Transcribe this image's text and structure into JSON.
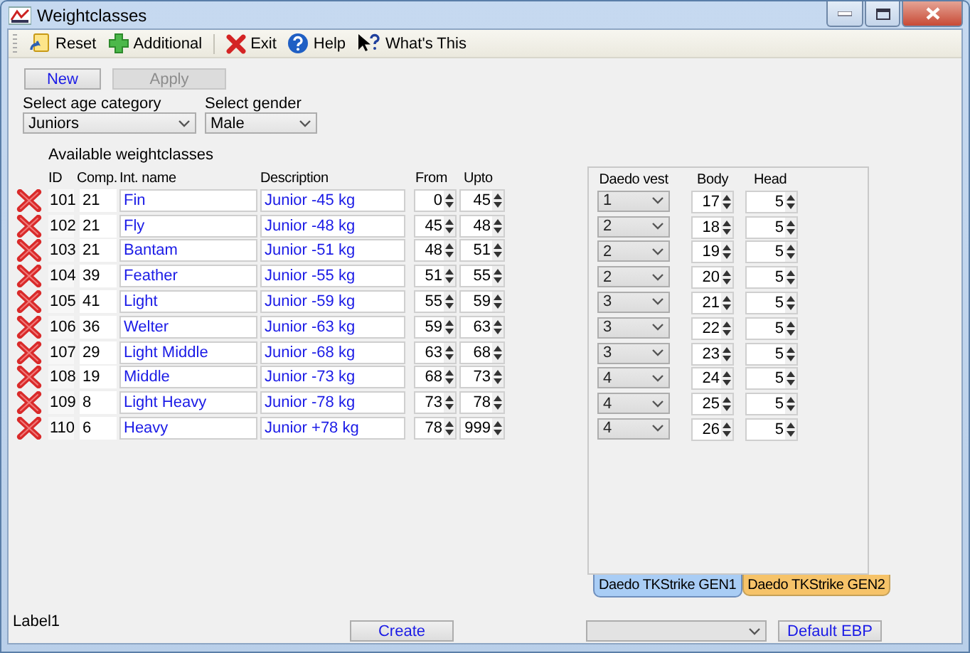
{
  "window": {
    "title": "Weightclasses"
  },
  "toolbar": [
    {
      "kind": "reset",
      "label": "Reset"
    },
    {
      "kind": "add",
      "label": "Additional"
    },
    {
      "kind": "separator"
    },
    {
      "kind": "exit",
      "label": "Exit"
    },
    {
      "kind": "help",
      "label": "Help"
    },
    {
      "kind": "whatsthis",
      "label": "What's This"
    }
  ],
  "actions": [
    {
      "label": "New",
      "disabled": false
    },
    {
      "label": "Apply",
      "disabled": true
    }
  ],
  "selects": [
    {
      "label": "Select age category",
      "value": "Juniors"
    },
    {
      "label": "Select gender",
      "value": "Male"
    }
  ],
  "section_label": "Available weightclasses",
  "columns": [
    "ID",
    "Comp.",
    "Int. name",
    "Description",
    "From",
    "Upto"
  ],
  "rows": [
    {
      "id": "101",
      "comp": "21",
      "name": "Fin",
      "description": "Junior -45 kg",
      "from": "0",
      "upto": "45"
    },
    {
      "id": "102",
      "comp": "21",
      "name": "Fly",
      "description": "Junior -48 kg",
      "from": "45",
      "upto": "48"
    },
    {
      "id": "103",
      "comp": "21",
      "name": "Bantam",
      "description": "Junior -51 kg",
      "from": "48",
      "upto": "51"
    },
    {
      "id": "104",
      "comp": "39",
      "name": "Feather",
      "description": "Junior -55 kg",
      "from": "51",
      "upto": "55"
    },
    {
      "id": "105",
      "comp": "41",
      "name": "Light",
      "description": "Junior -59 kg",
      "from": "55",
      "upto": "59"
    },
    {
      "id": "106",
      "comp": "36",
      "name": "Welter",
      "description": "Junior -63 kg",
      "from": "59",
      "upto": "63"
    },
    {
      "id": "107",
      "comp": "29",
      "name": "Light Middle",
      "description": "Junior -68 kg",
      "from": "63",
      "upto": "68"
    },
    {
      "id": "108",
      "comp": "19",
      "name": "Middle",
      "description": "Junior -73 kg",
      "from": "68",
      "upto": "73"
    },
    {
      "id": "109",
      "comp": "8",
      "name": "Light Heavy",
      "description": "Junior -78 kg",
      "from": "73",
      "upto": "78"
    },
    {
      "id": "110",
      "comp": "6",
      "name": "Heavy",
      "description": "Junior +78 kg",
      "from": "78",
      "upto": "999"
    }
  ],
  "vest_columns": [
    "Daedo vest",
    "Body",
    "Head"
  ],
  "vest_rows": [
    {
      "vest": "1",
      "body": "17",
      "head": "5"
    },
    {
      "vest": "2",
      "body": "18",
      "head": "5"
    },
    {
      "vest": "2",
      "body": "19",
      "head": "5"
    },
    {
      "vest": "2",
      "body": "20",
      "head": "5"
    },
    {
      "vest": "3",
      "body": "21",
      "head": "5"
    },
    {
      "vest": "3",
      "body": "22",
      "head": "5"
    },
    {
      "vest": "3",
      "body": "23",
      "head": "5"
    },
    {
      "vest": "4",
      "body": "24",
      "head": "5"
    },
    {
      "vest": "4",
      "body": "25",
      "head": "5"
    },
    {
      "vest": "4",
      "body": "26",
      "head": "5"
    }
  ],
  "tabs": [
    {
      "label": "Daedo TKStrike GEN1",
      "selected": true,
      "color": "#a9cdf5"
    },
    {
      "label": "Daedo TKStrike GEN2",
      "selected": false,
      "color": "#fbc35e"
    }
  ],
  "status_label": "Label1",
  "create_button": "Create",
  "default_button": "Default EBP"
}
